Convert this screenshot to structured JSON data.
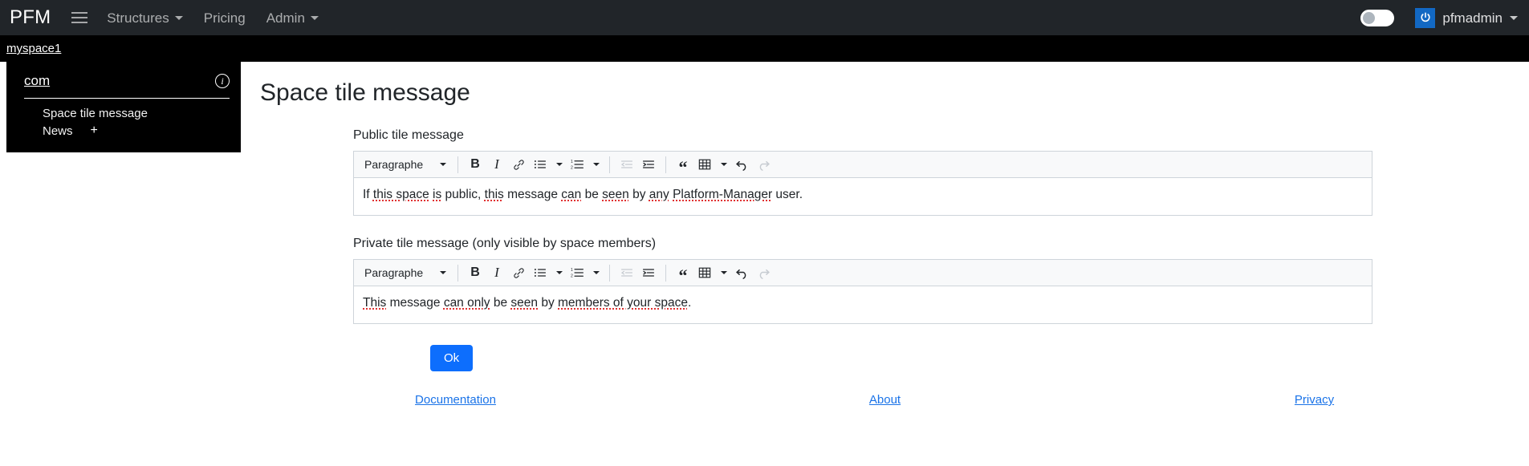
{
  "navbar": {
    "brand": "PFM",
    "menu_icon": "hamburger-icon",
    "links": [
      {
        "label": "Structures",
        "has_caret": true
      },
      {
        "label": "Pricing",
        "has_caret": false
      },
      {
        "label": "Admin",
        "has_caret": true
      }
    ],
    "theme_toggle": {
      "name": "theme-toggle",
      "state": "off"
    },
    "user": {
      "name": "pfmadmin",
      "icon": "power-icon",
      "icon_bg": "#1268c3"
    }
  },
  "breadcrumb": {
    "items": [
      {
        "label": "myspace1"
      }
    ]
  },
  "space_panel": {
    "title": "com",
    "info_icon": "info-icon",
    "items": [
      {
        "label": "Space tile message",
        "add": null
      },
      {
        "label": "News",
        "add": "+"
      }
    ]
  },
  "main": {
    "page_title": "Space tile message",
    "public_field": {
      "label": "Public tile message",
      "content_parts": [
        {
          "text": "If ",
          "spell": false
        },
        {
          "text": "this space",
          "spell": true
        },
        {
          "text": " ",
          "spell": false
        },
        {
          "text": "is",
          "spell": true
        },
        {
          "text": " public, ",
          "spell": false
        },
        {
          "text": "this",
          "spell": true
        },
        {
          "text": " message ",
          "spell": false
        },
        {
          "text": "can",
          "spell": true
        },
        {
          "text": " be ",
          "spell": false
        },
        {
          "text": "seen",
          "spell": true
        },
        {
          "text": " by ",
          "spell": false
        },
        {
          "text": "any",
          "spell": true
        },
        {
          "text": " ",
          "spell": false
        },
        {
          "text": "Platform-Manager",
          "spell": true
        },
        {
          "text": " user.",
          "spell": false
        }
      ],
      "content_plain": "If this space is public, this message can be seen by any Platform-Manager user."
    },
    "private_field": {
      "label": "Private tile message (only visible by space members)",
      "content_parts": [
        {
          "text": "This",
          "spell": true
        },
        {
          "text": " message ",
          "spell": false
        },
        {
          "text": "can only",
          "spell": true
        },
        {
          "text": " be ",
          "spell": false
        },
        {
          "text": "seen",
          "spell": true
        },
        {
          "text": " by ",
          "spell": false
        },
        {
          "text": "members of your space",
          "spell": true
        },
        {
          "text": ".",
          "spell": false
        }
      ],
      "content_plain": "This message can only be seen by members of your space."
    },
    "toolbar": {
      "format_value": "Paragraphe",
      "buttons": [
        {
          "name": "bold-icon",
          "glyph": "B"
        },
        {
          "name": "italic-icon",
          "glyph": "I"
        },
        {
          "name": "link-icon",
          "glyph": "🔗"
        },
        {
          "name": "bulleted-list-icon",
          "glyph": "☰"
        },
        {
          "name": "numbered-list-icon",
          "glyph": "☰"
        },
        {
          "name": "outdent-icon",
          "glyph": "⇤"
        },
        {
          "name": "indent-icon",
          "glyph": "⇥"
        },
        {
          "name": "blockquote-icon",
          "glyph": "“"
        },
        {
          "name": "table-icon",
          "glyph": "▦"
        },
        {
          "name": "undo-icon",
          "glyph": "↶"
        },
        {
          "name": "redo-icon",
          "glyph": "↷"
        }
      ]
    },
    "ok_button": "Ok"
  },
  "footer": {
    "links": [
      {
        "label": "Documentation"
      },
      {
        "label": "About"
      },
      {
        "label": "Privacy"
      }
    ]
  },
  "colors": {
    "navbar_bg": "#212529",
    "crumb_bg": "#000000",
    "panel_bg": "#000000",
    "primary": "#0d6efd",
    "link": "#1a73e8",
    "spellcheck": "#e03131"
  }
}
